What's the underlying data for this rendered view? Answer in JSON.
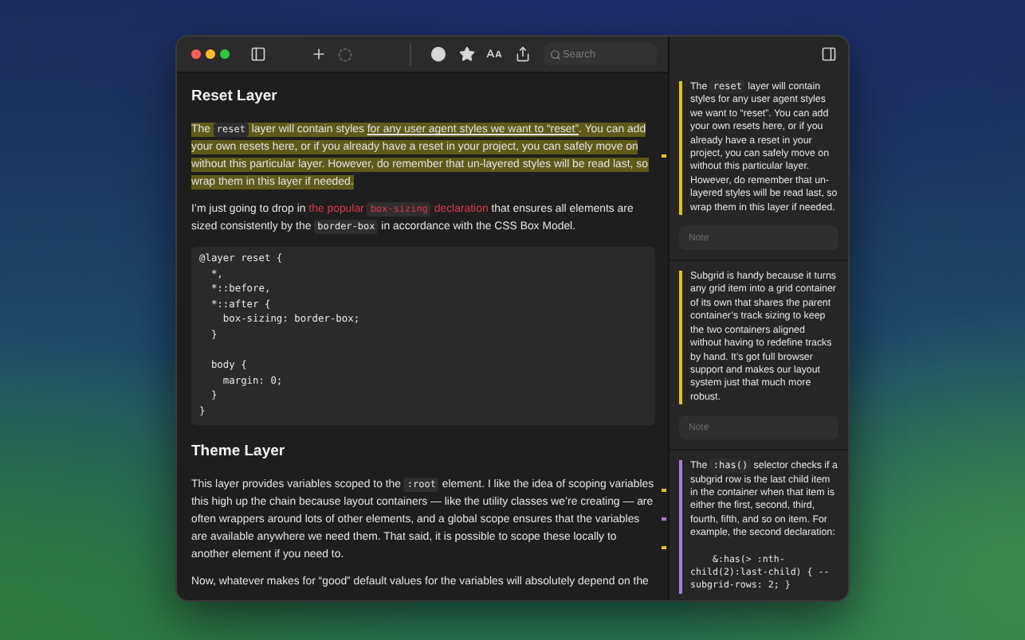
{
  "window": {
    "search": {
      "placeholder": "Search"
    }
  },
  "article": [
    {
      "kind": "heading",
      "text": "Reset Layer"
    },
    {
      "kind": "paragraph",
      "highlighted": true,
      "segments": [
        {
          "kind": "text",
          "text": "The "
        },
        {
          "kind": "code",
          "text": "reset"
        },
        {
          "kind": "text",
          "text": " layer will contain styles "
        },
        {
          "kind": "underline",
          "text": "for any user agent styles we want to “reset”"
        },
        {
          "kind": "text",
          "text": ". You can add your own resets here, or if you already have a reset in your project, you can safely move on without this particular layer. However, do remember that un-layered styles will be read last, so wrap them in this layer if needed."
        }
      ],
      "line_marks": [
        {
          "color": "#e3c21c"
        }
      ]
    },
    {
      "kind": "paragraph",
      "highlighted": false,
      "segments": [
        {
          "kind": "text",
          "text": "I’m just going to drop in "
        },
        {
          "kind": "link",
          "parts": [
            {
              "kind": "text",
              "text": "the popular "
            },
            {
              "kind": "code",
              "text": "box-sizing"
            },
            {
              "kind": "text",
              "text": " declaration"
            }
          ]
        },
        {
          "kind": "text",
          "text": " that ensures all elements are sized consistently by the "
        },
        {
          "kind": "code",
          "text": "border-box"
        },
        {
          "kind": "text",
          "text": " in accordance with the CSS Box Model."
        }
      ]
    },
    {
      "kind": "code",
      "text": "@layer reset {\n  *,\n  *::before,\n  *::after {\n    box-sizing: border-box;\n  }\n\n  body {\n    margin: 0;\n  }\n}"
    },
    {
      "kind": "heading",
      "text": "Theme Layer"
    },
    {
      "kind": "paragraph",
      "highlighted": false,
      "segments": [
        {
          "kind": "text",
          "text": "This layer provides variables scoped to the "
        },
        {
          "kind": "code",
          "text": ":root"
        },
        {
          "kind": "text",
          "text": " element. I like the idea of scoping variables this high up the chain because layout containers — like the utility classes we’re creating — are often wrappers around lots of other elements, and a global scope ensures that the variables are available anywhere we need them. That said, it is possible to scope these locally to another element if you need to."
        }
      ],
      "line_marks": [
        {
          "color": "#e3c21c"
        },
        {
          "color": "#a77fd8"
        },
        {
          "color": "#e3c21c"
        }
      ]
    },
    {
      "kind": "paragraph",
      "highlighted": false,
      "segments": [
        {
          "kind": "text",
          "text": "Now, whatever makes for “good” default values for the variables will absolutely depend on the"
        }
      ]
    }
  ],
  "notes": [
    {
      "color": "#e3c21c",
      "segments": [
        {
          "kind": "text",
          "text": "The "
        },
        {
          "kind": "code",
          "text": "reset"
        },
        {
          "kind": "text",
          "text": " layer will contain styles for any user agent styles we want to “reset”. You can add your own resets here, or if you already have a reset in your project, you can safely move on without this particular layer. However, do remember that un-layered styles will be read last, so wrap them in this layer if needed."
        }
      ],
      "placeholder": "Note"
    },
    {
      "color": "#e3c21c",
      "segments": [
        {
          "kind": "text",
          "text": "Subgrid is handy because it turns any grid item into a grid container of its own that shares the parent container’s track sizing to keep the two containers aligned without having to redefine tracks by hand. It’s got full browser support and makes our layout system just that much more robust."
        }
      ],
      "placeholder": "Note"
    },
    {
      "color": "#a77fd8",
      "segments": [
        {
          "kind": "text",
          "text": "The "
        },
        {
          "kind": "code",
          "text": ":has()"
        },
        {
          "kind": "text",
          "text": " selector checks if a subgrid row is the last child item in the container when that item is either the first, second, third, fourth, fifth, and so on item. For example, the second declaration:"
        }
      ],
      "code": "    &:has(> :nth-child(2):last-child) { --subgrid-rows: 2; }"
    }
  ]
}
